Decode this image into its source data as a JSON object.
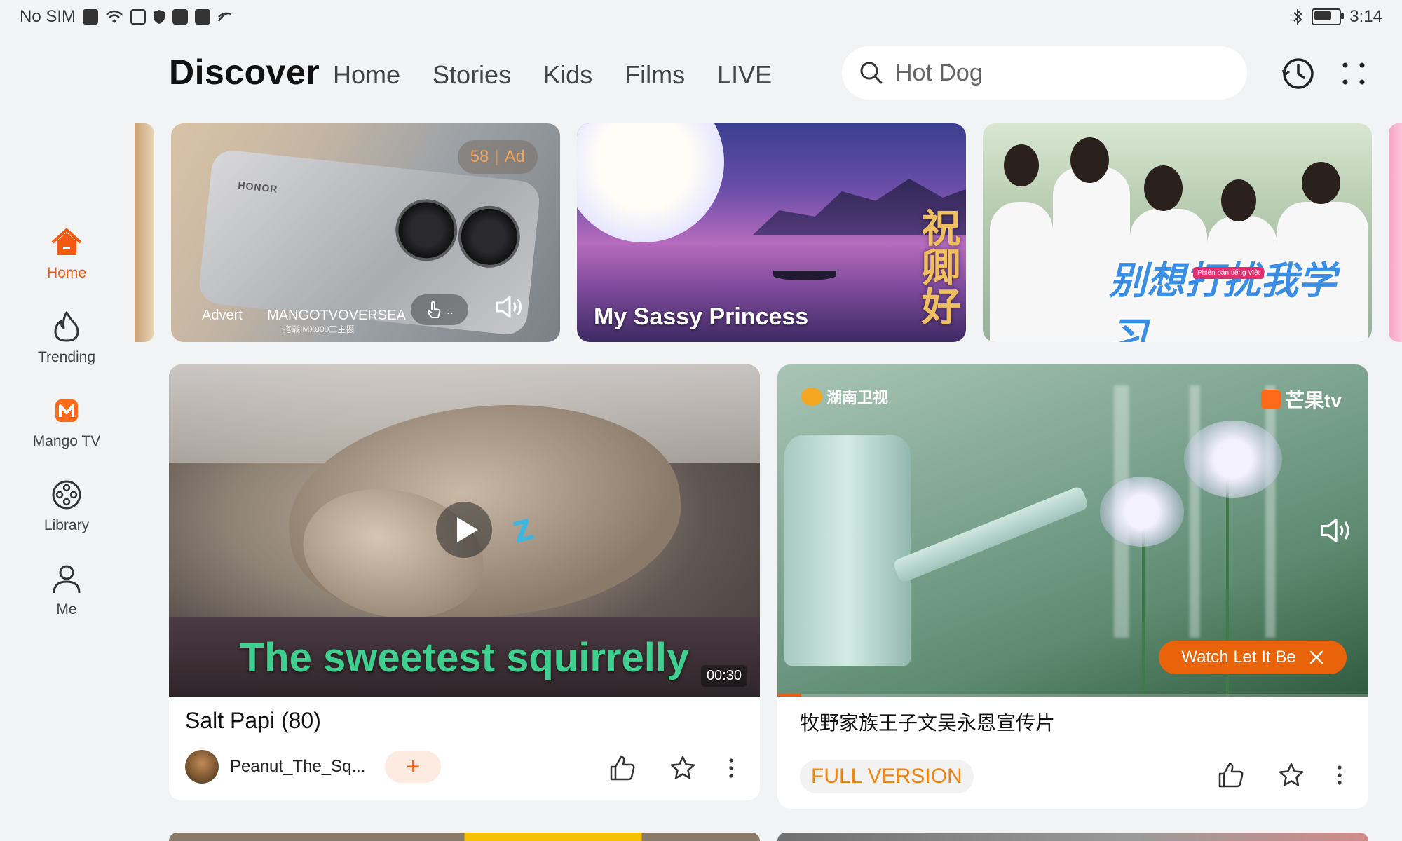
{
  "status_bar": {
    "carrier": "No SIM",
    "time": "3:14",
    "battery_level": 0.7
  },
  "header": {
    "title": "Discover",
    "tabs": [
      {
        "label": "Home"
      },
      {
        "label": "Stories"
      },
      {
        "label": "Kids"
      },
      {
        "label": "Films"
      },
      {
        "label": "LIVE"
      }
    ],
    "search": {
      "placeholder": "Hot Dog"
    }
  },
  "sidebar": {
    "items": [
      {
        "label": "Home",
        "icon": "home-icon",
        "active": true
      },
      {
        "label": "Trending",
        "icon": "flame-icon",
        "active": false
      },
      {
        "label": "Mango TV",
        "icon": "mango-tv-icon",
        "active": false
      },
      {
        "label": "Library",
        "icon": "film-reel-icon",
        "active": false
      },
      {
        "label": "Me",
        "icon": "person-icon",
        "active": false
      }
    ]
  },
  "carousel": {
    "ad": {
      "countdown": "58",
      "ad_tag": "Ad",
      "label": "Advert",
      "brand": "MANGOTVOVERSEA",
      "sub": "搭载IMX800三主摄",
      "phone_brand": "HONOR"
    },
    "featured": {
      "caption": "My Sassy Princess",
      "calligraphy": "祝卿好"
    },
    "third": {
      "title": "别想打扰我学习",
      "tag": "Phiên bản tiếng Việt"
    }
  },
  "videos": [
    {
      "title": "Salt Papi (80)",
      "caption": "The sweetest squirrelly",
      "duration": "00:30",
      "author": "Peanut_The_Sq...",
      "follow": "+"
    },
    {
      "title": "牧野家族王子文吴永恩宣传片",
      "channel_logo": "湖南卫视",
      "platform_logo": "芒果tv",
      "watch_button": "Watch Let It Be",
      "badge": "FULL VERSION",
      "progress": 0.04
    }
  ],
  "colors": {
    "accent": "#f25a12",
    "background": "#f1f3f5"
  }
}
